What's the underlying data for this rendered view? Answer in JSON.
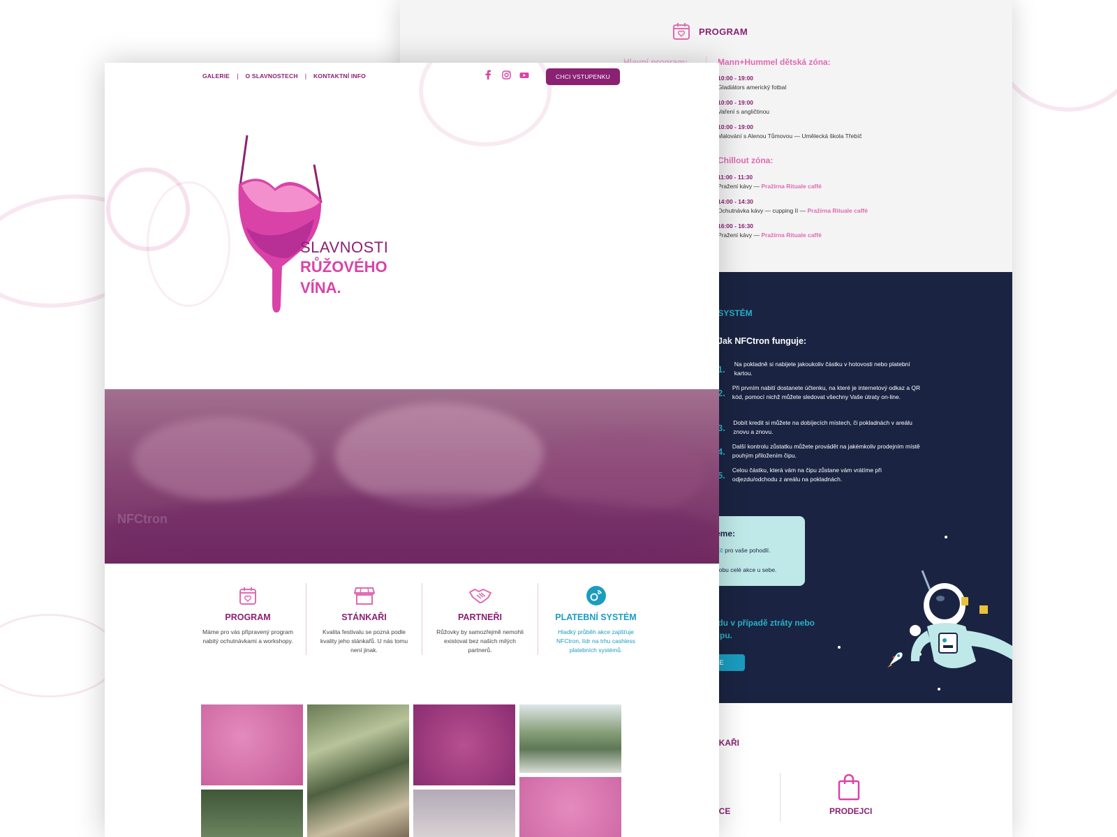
{
  "front": {
    "nav": [
      "GALERIE",
      "O SLAVNOSTECH",
      "KONTAKTNÍ INFO"
    ],
    "nav_sep": "|",
    "social_icons": [
      "facebook-icon",
      "instagram-icon",
      "youtube-icon"
    ],
    "cta_label": "CHCI VSTUPENKU",
    "logo": {
      "line1": "SLAVNOSTI",
      "line2": "RŮŽOVÉHO",
      "line3": "VÍNA."
    },
    "hero_watermark": "NFCtron",
    "features": [
      {
        "icon": "calendar-heart-icon",
        "title": "PROGRAM",
        "desc": "Máme pro vás připravený program nabitý ochutnávkami a workshopy."
      },
      {
        "icon": "market-stall-icon",
        "title": "STÁNKAŘI",
        "desc": "Kvalita festivalu se pozná podle kvality jeho stánkařů. U nás tomu není jinak."
      },
      {
        "icon": "handshake-icon",
        "title": "PARTNEŘI",
        "desc": "Růžovky by samozřejmě nemohli existovat bez našich milých partnerů."
      },
      {
        "icon": "nfc-chip-icon",
        "title": "PLATEBNÍ SYSTÉM",
        "desc": "Hladký průběh akce zajišťuje NFCtron, lídr na trhu cashless platebních systémů."
      }
    ]
  },
  "back": {
    "program_title": "PROGRAM",
    "hlavni_program": "Hlavní program:",
    "zone1_title": "Mann+Hummel dětská zóna:",
    "zone1": [
      {
        "time": "10:00 - 19:00",
        "text": "Gladiátors americký fotbal"
      },
      {
        "time": "10:00 - 19:00",
        "text": "Vaření s angličtinou"
      },
      {
        "time": "10:00 - 19:00",
        "text": "Malování s Alenou Tůmovou — Umělecká škola Třebíč"
      }
    ],
    "zone2_title": "Chillout zóna:",
    "zone2": [
      {
        "time": "11:00 - 11:30",
        "text": "Pražení kávy — ",
        "place": "Pražírna Rituale caffé"
      },
      {
        "time": "14:00 - 14:30",
        "text": "Ochutnávka kávy — cupping II — ",
        "place": "Pražírna Rituale caffé"
      },
      {
        "time": "16:00 - 16:30",
        "text": "Pražení kávy — ",
        "place": "Pražírna Rituale caffé"
      }
    ],
    "pay_title": "NÍ SYSTÉM",
    "how_title": "Jak NFCtron funguje:",
    "steps": [
      {
        "n": "1.",
        "text": "Na pokladně si nabijete jakoukoliv částku v hotovosti nebo platební kartou."
      },
      {
        "n": "2.",
        "text": "Při prvním nabití dostanete účtenku, na které je internetový odkaz a QR kód, pomocí nichž můžete sledovat všechny Vaše útraty on-line."
      },
      {
        "n": "3.",
        "text": "Dobít kredit si můžete na dobíjecích místech, či pokladnách v areálu znovu a znovu."
      },
      {
        "n": "4.",
        "text": "Další kontrolu zůstatku můžete provádět na jakémkoliv prodejním místě pouhým přiložením čipu."
      },
      {
        "n": "5.",
        "text": "Celou částku, která vám na čipu zůstane vám vrátíme při odjezdu/odchodu z areálu na pokladnách."
      }
    ],
    "mint_title": "eme:",
    "mint_line1_accent": "Kč",
    "mint_line1": " pro vaše pohodlí.",
    "mint_line2": "dobu celé akce u sebe.",
    "lost_line1": "odu v případě ztráty nebo",
    "lost_line2": "čipu.",
    "vice_label": "VÍCE",
    "stankari_title": "NKAŘI",
    "ace_label": "ACE",
    "prodejci_label": "PRODEJCI"
  },
  "colors": {
    "brand_purple": "#8a2173",
    "brand_pink": "#d943a8",
    "accent_cyan": "#1a9dc0",
    "navy": "#1a2442"
  }
}
